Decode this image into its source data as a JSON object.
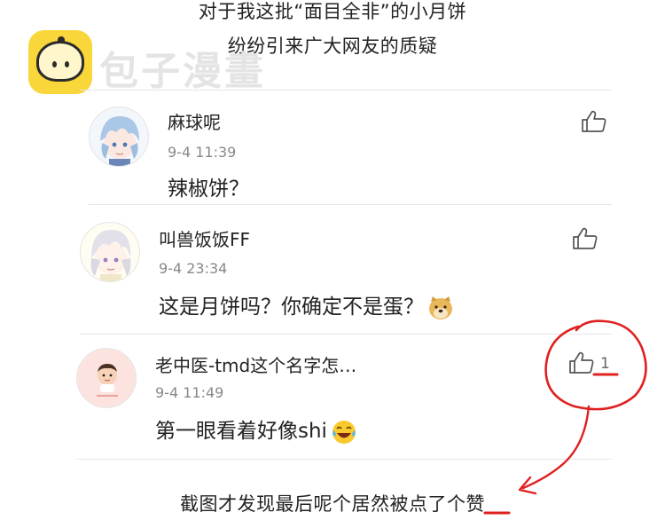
{
  "captions": {
    "top_line1": "对于我这批“面目全非”的小月饼",
    "top_line2": "纷纷引来广大网友的质疑",
    "bottom": "截图才发现最后呢个居然被点了个赞"
  },
  "watermark": {
    "text": "包子漫畫",
    "icon": "bun-logo-icon"
  },
  "comments": [
    {
      "username": "麻球呢",
      "time": "9-4 11:39",
      "text": "辣椒饼？",
      "likes": "",
      "avatar": "anime-boy-blue-hair-avatar"
    },
    {
      "username": "叫兽饭饭FF",
      "time": "9-4 23:34",
      "text": "这是月饼吗？你确定不是蛋？",
      "likes": "",
      "avatar": "anime-boy-silver-hair-avatar",
      "emoji": "doge-emoji"
    },
    {
      "username": "老中医-tmd这个名字怎…",
      "time": "9-4 11:49",
      "text": "第一眼看着好像shi",
      "likes": "1",
      "avatar": "baby-photo-avatar",
      "emoji": "laughing-tears-emoji"
    }
  ],
  "colors": {
    "annotation_red": "#e02020",
    "watermark_yellow": "#f9d63a",
    "muted_text": "#888888"
  }
}
